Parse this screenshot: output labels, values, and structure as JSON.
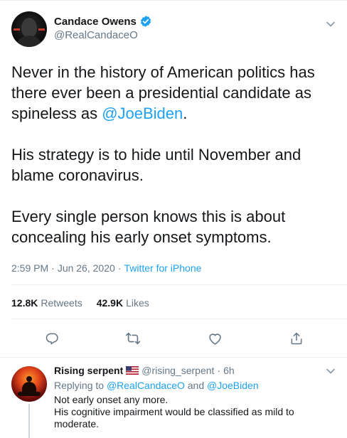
{
  "tweet": {
    "author": {
      "name": "Candace Owens",
      "handle": "@RealCandaceO"
    },
    "text": {
      "line1": "Never in the history of American politics has",
      "line2": "there ever been a presidential candidate as",
      "line3_prefix": "spineless as ",
      "line3_mention": "@JoeBiden",
      "line3_suffix": ".",
      "line4": "His strategy is to hide until November and",
      "line5": "blame coronavirus.",
      "line6": "Every single person knows this is about",
      "line7": "concealing his early onset symptoms."
    },
    "time": "2:59 PM",
    "sep1": "·",
    "date": "Jun 26, 2020",
    "sep2": "·",
    "source": "Twitter for iPhone",
    "stats": {
      "retweets_count": "12.8K",
      "retweets_label": "Retweets",
      "likes_count": "42.9K",
      "likes_label": "Likes"
    },
    "actions": [
      "reply-icon",
      "retweet-icon",
      "like-icon",
      "share-icon"
    ]
  },
  "reply": {
    "name": "Rising serpent",
    "flag": "us-flag-icon",
    "handle": "@rising_serpent",
    "sep": "·",
    "age": "6h",
    "replying_prefix": "Replying to",
    "replying_to_1": "@RealCandaceO",
    "replying_and": "and",
    "replying_to_2": "@JoeBiden",
    "line1": "Not early onset any more.",
    "line2": "His cognitive impairment would be classified as mild to",
    "line3": "moderate."
  },
  "colors": {
    "accent": "#1da1f2",
    "text": "#14171a",
    "muted": "#657786",
    "divider": "#e6ecf0"
  }
}
